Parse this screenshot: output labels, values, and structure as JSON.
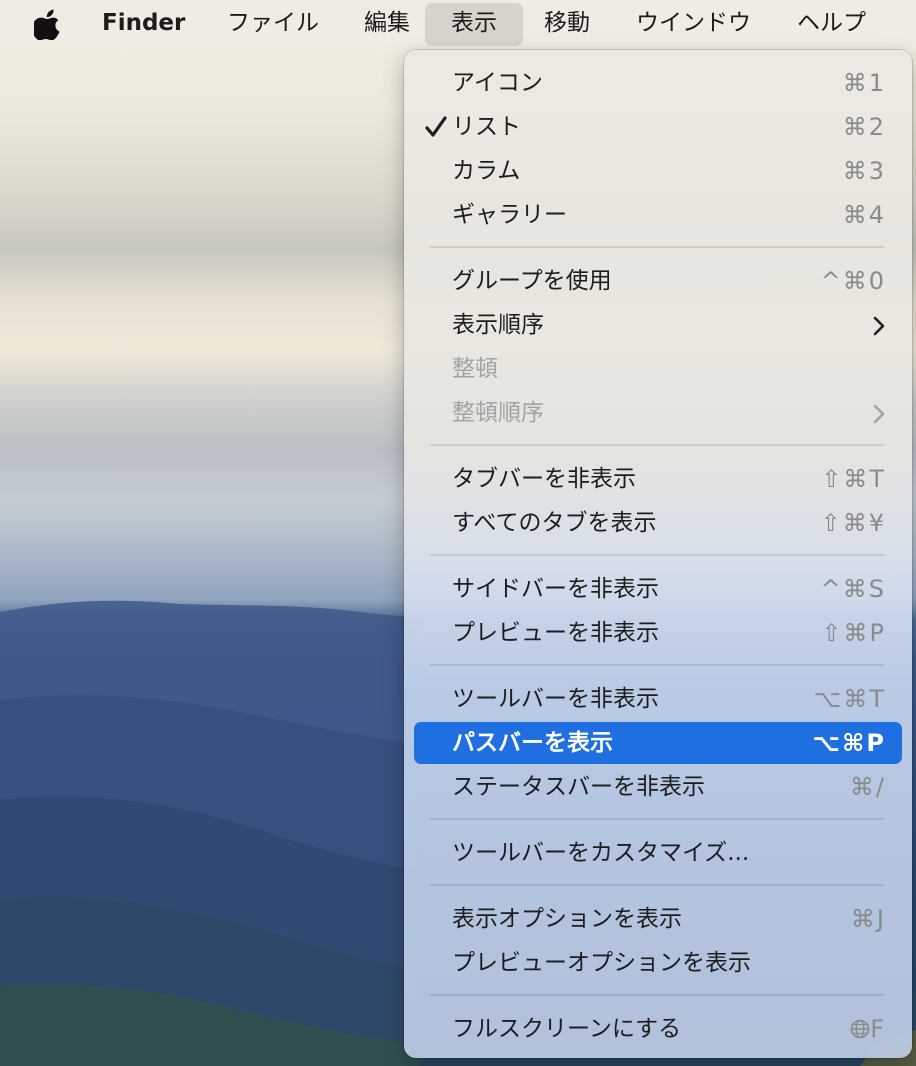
{
  "menubar": {
    "apple_icon": "apple-logo-icon",
    "app_name": "Finder",
    "items": [
      "ファイル",
      "編集",
      "表示",
      "移動",
      "ウインドウ",
      "ヘルプ"
    ],
    "active_item": "表示"
  },
  "menu": {
    "groups": [
      [
        {
          "label": "アイコン",
          "shortcut": "⌘1"
        },
        {
          "label": "リスト",
          "shortcut": "⌘2",
          "checked": true
        },
        {
          "label": "カラム",
          "shortcut": "⌘3"
        },
        {
          "label": "ギャラリー",
          "shortcut": "⌘4"
        }
      ],
      [
        {
          "label": "グループを使用",
          "shortcut": "^⌘0"
        },
        {
          "label": "表示順序",
          "submenu": true
        },
        {
          "label": "整頓",
          "disabled": true
        },
        {
          "label": "整頓順序",
          "submenu": true,
          "disabled": true
        }
      ],
      [
        {
          "label": "タブバーを非表示",
          "shortcut": "⇧⌘T"
        },
        {
          "label": "すべてのタブを表示",
          "shortcut": "⇧⌘¥"
        }
      ],
      [
        {
          "label": "サイドバーを非表示",
          "shortcut": "^⌘S"
        },
        {
          "label": "プレビューを非表示",
          "shortcut": "⇧⌘P"
        }
      ],
      [
        {
          "label": "ツールバーを非表示",
          "shortcut": "⌥⌘T"
        },
        {
          "label": "パスバーを表示",
          "shortcut": "⌥⌘P",
          "selected": true
        },
        {
          "label": "ステータスバーを非表示",
          "shortcut": "⌘/"
        }
      ],
      [
        {
          "label": "ツールバーをカスタマイズ..."
        }
      ],
      [
        {
          "label": "表示オプションを表示",
          "shortcut": "⌘J"
        },
        {
          "label": "プレビューオプションを表示"
        }
      ],
      [
        {
          "label": "フルスクリーンにする",
          "shortcut": "F",
          "shortcut_icon": "globe-icon"
        }
      ]
    ]
  },
  "colors": {
    "selection": "#1f6fe0",
    "text": "#1d1d1d",
    "shortcut": "#8a8a8a",
    "disabled": "#a3a3a3"
  }
}
